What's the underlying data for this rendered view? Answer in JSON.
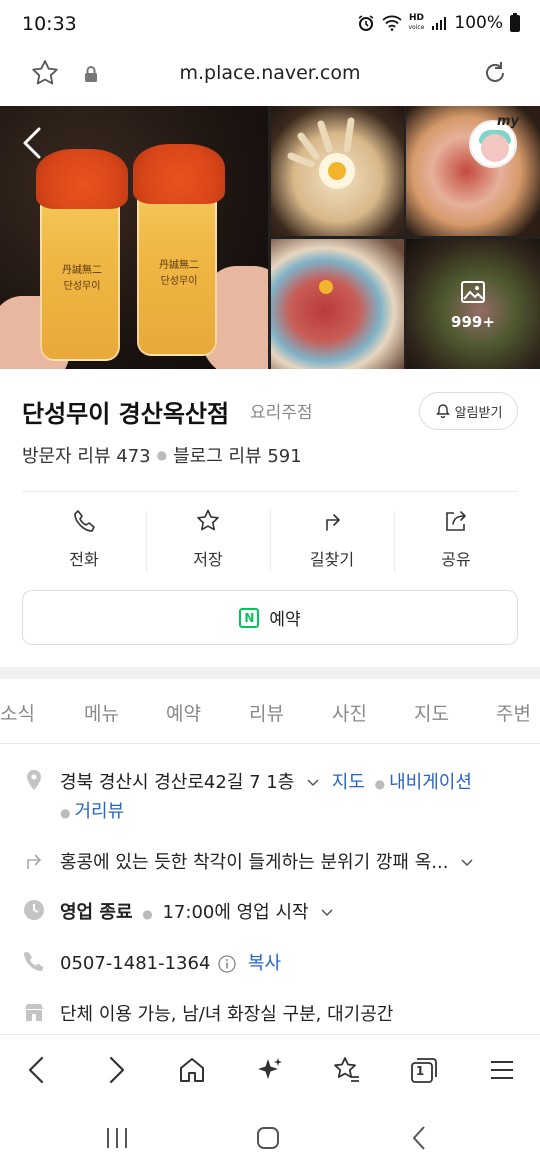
{
  "status_bar": {
    "time": "10:33",
    "hd_label": "HD",
    "voice_label": "voice",
    "battery": "100%"
  },
  "url_bar": {
    "url": "m.place.naver.com"
  },
  "photos": {
    "more_count": "999+",
    "glass_label": "丹誠無二\n단성무이",
    "avatar_tag": "my"
  },
  "place": {
    "name": "단성무이 경산옥산점",
    "category": "요리주점",
    "alarm_label": "알림받기",
    "visitor_reviews": "방문자 리뷰 473",
    "blog_reviews": "블로그 리뷰 591"
  },
  "actions": [
    {
      "label": "전화",
      "icon": "phone-icon"
    },
    {
      "label": "저장",
      "icon": "star-icon"
    },
    {
      "label": "길찾기",
      "icon": "directions-icon"
    },
    {
      "label": "공유",
      "icon": "share-icon"
    }
  ],
  "reserve": {
    "badge": "N",
    "label": "예약"
  },
  "tabs": [
    "소식",
    "메뉴",
    "예약",
    "리뷰",
    "사진",
    "지도",
    "주변"
  ],
  "info": {
    "address": "경북 경산시 경산로42길 7 1층",
    "address_map": "지도",
    "address_nav": "내비게이션",
    "address_street": "거리뷰",
    "description": "홍콩에 있는 듯한 착각이 들게하는 분위기 깡패 옥...",
    "hours_status": "영업 종료",
    "hours_next": "17:00에 영업 시작",
    "phone": "0507-1481-1364",
    "phone_copy": "복사",
    "facilities": "단체 이용 가능, 남/녀 화장실 구분, 대기공간"
  },
  "browser_bar": {
    "tab_count": "1"
  },
  "colors": {
    "link": "#2a64c8",
    "naver_green": "#03c75a",
    "text_grey": "#8a8a8a"
  }
}
